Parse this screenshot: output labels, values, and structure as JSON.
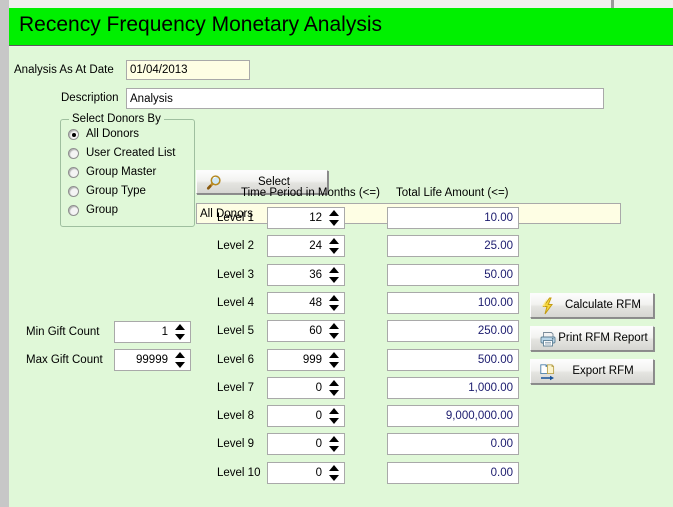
{
  "window": {
    "title": "Recency Frequency Monetary Analysis",
    "title_bar_color": "#00f000",
    "client_bg_color": "#e0f8d8"
  },
  "header_fields": {
    "date_label": "Analysis As At Date",
    "date_value": "01/04/2013",
    "description_label": "Description",
    "description_value": "Analysis"
  },
  "donors_group": {
    "legend": "Select Donors By",
    "options": [
      {
        "label": "All Donors",
        "selected": true
      },
      {
        "label": "User Created List",
        "selected": false
      },
      {
        "label": "Group Master",
        "selected": false
      },
      {
        "label": "Group Type",
        "selected": false
      },
      {
        "label": "Group",
        "selected": false
      }
    ]
  },
  "select_button": {
    "label": "Select",
    "icon": "magnifier-icon"
  },
  "selection_display": {
    "value": "All Donors"
  },
  "gift_count": {
    "min_label": "Min Gift Count",
    "min_value": "1",
    "max_label": "Max Gift Count",
    "max_value": "99999"
  },
  "levels_table": {
    "col_time_header": "Time Period in Months (<=)",
    "col_amount_header": "Total Life Amount (<=)",
    "rows": [
      {
        "level": "Level 1",
        "months": "12",
        "amount": "10.00"
      },
      {
        "level": "Level 2",
        "months": "24",
        "amount": "25.00"
      },
      {
        "level": "Level 3",
        "months": "36",
        "amount": "50.00"
      },
      {
        "level": "Level 4",
        "months": "48",
        "amount": "100.00"
      },
      {
        "level": "Level 5",
        "months": "60",
        "amount": "250.00"
      },
      {
        "level": "Level 6",
        "months": "999",
        "amount": "500.00"
      },
      {
        "level": "Level 7",
        "months": "0",
        "amount": "1,000.00"
      },
      {
        "level": "Level 8",
        "months": "0",
        "amount": "9,000,000.00"
      },
      {
        "level": "Level 9",
        "months": "0",
        "amount": "0.00"
      },
      {
        "level": "Level 10",
        "months": "0",
        "amount": "0.00"
      }
    ]
  },
  "actions": [
    {
      "label": "Calculate RFM",
      "icon": "lightning-bolt-icon"
    },
    {
      "label": "Print RFM Report",
      "icon": "printer-icon"
    },
    {
      "label": "Export RFM",
      "icon": "export-documents-icon"
    }
  ]
}
